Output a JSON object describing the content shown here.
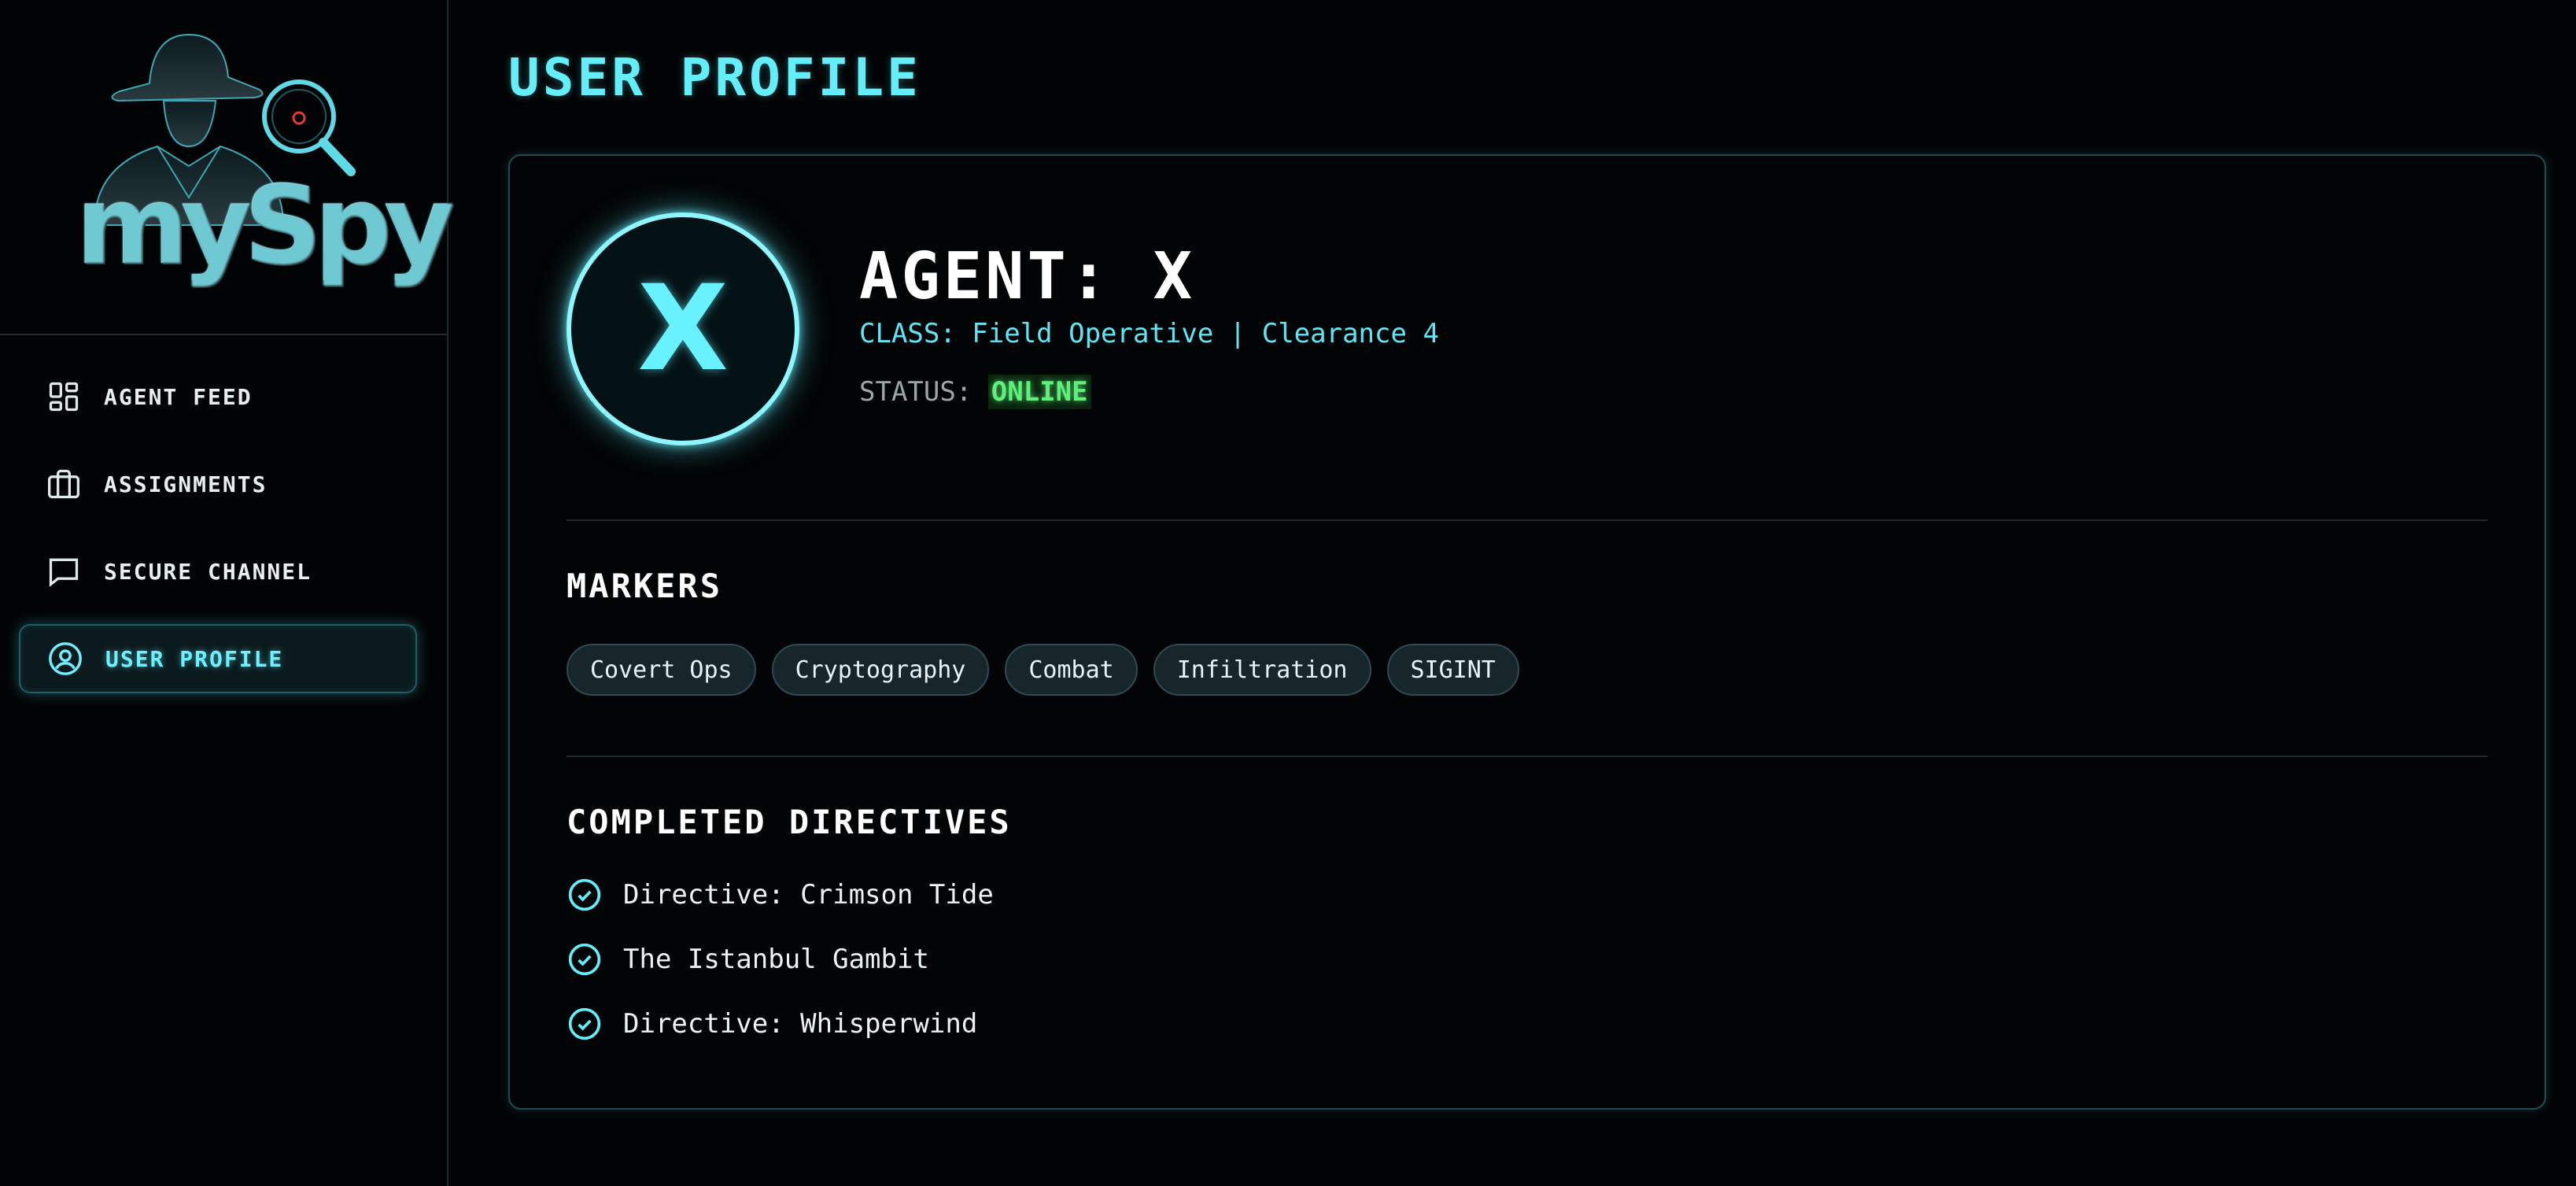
{
  "sidebar": {
    "logo_text": "mySpy",
    "items": [
      {
        "label": "AGENT FEED",
        "icon": "dashboard-icon"
      },
      {
        "label": "ASSIGNMENTS",
        "icon": "briefcase-icon"
      },
      {
        "label": "SECURE CHANNEL",
        "icon": "chat-icon"
      },
      {
        "label": "USER PROFILE",
        "icon": "user-circle-icon",
        "active": true
      }
    ]
  },
  "main": {
    "page_title": "USER PROFILE",
    "profile": {
      "avatar_letter": "X",
      "name": "AGENT: X",
      "class_line": "CLASS: Field Operative | Clearance 4",
      "status_label": "STATUS:",
      "status_value": "ONLINE"
    },
    "markers": {
      "title": "MARKERS",
      "tags": [
        "Covert Ops",
        "Cryptography",
        "Combat",
        "Infiltration",
        "SIGINT"
      ]
    },
    "directives": {
      "title": "COMPLETED DIRECTIVES",
      "items": [
        "Directive: Crimson Tide",
        "The Istanbul Gambit",
        "Directive: Whisperwind"
      ]
    }
  },
  "colors": {
    "accent": "#63eefa",
    "online": "#5ff07a",
    "background": "#020304"
  }
}
